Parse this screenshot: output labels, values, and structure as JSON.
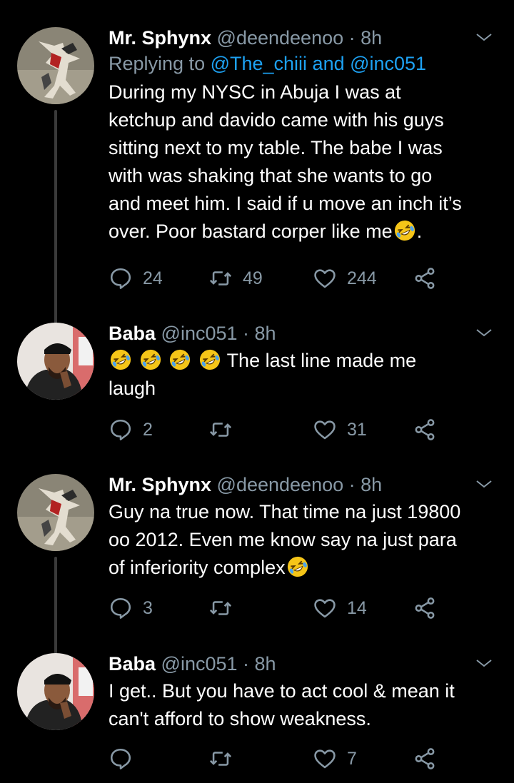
{
  "tweets": [
    {
      "name": "Mr. Sphynx",
      "handle": "@deendeenoo",
      "time": "· 8h",
      "reply_prefix": "Replying to ",
      "reply_users": "@The_chiii and @inc051",
      "text_lines": [
        "During my NYSC in Abuja I was at",
        "ketchup and davido came with his guys",
        "sitting next to my table. The babe I was",
        "with was shaking that she wants to go",
        "and meet him. I said if u move an inch it’s",
        "over. Poor bastard corper like me"
      ],
      "text_end": ".",
      "replies": "24",
      "retweets": "49",
      "likes": "244"
    },
    {
      "name": "Baba",
      "handle": "@inc051",
      "time": "· 8h",
      "text_after_emojis": "The last line made me",
      "text_line2": "laugh",
      "replies": "2",
      "retweets": "",
      "likes": "31"
    },
    {
      "name": "Mr. Sphynx",
      "handle": "@deendeenoo",
      "time": "· 8h",
      "text_lines": [
        "Guy na true now. That time na just 19800",
        "oo 2012. Even me know say na just para",
        "of inferiority complex"
      ],
      "replies": "3",
      "retweets": "",
      "likes": "14"
    },
    {
      "name": "Baba",
      "handle": "@inc051",
      "time": "· 8h",
      "text_lines": [
        "I get.. But you have to act cool & mean it",
        "can't afford to show weakness."
      ],
      "replies": "",
      "retweets": "",
      "likes": "7"
    }
  ],
  "icons": {
    "reply": "reply-icon",
    "retweet": "retweet-icon",
    "like": "heart-icon",
    "share": "share-icon",
    "emoji": "rolling-on-floor-laughing-emoji",
    "caret": "chevron-down-icon"
  },
  "colors": {
    "background": "#000000",
    "muted": "#8899a6",
    "link": "#1da1f2",
    "emoji": "#f5c518"
  }
}
